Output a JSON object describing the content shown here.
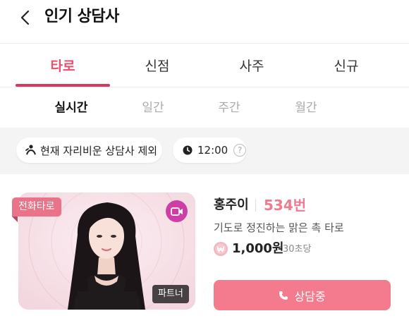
{
  "header": {
    "title": "인기 상담사",
    "back_icon": "chevron-left-icon"
  },
  "tabs": [
    {
      "label": "타로",
      "active": true
    },
    {
      "label": "신점",
      "active": false
    },
    {
      "label": "사주",
      "active": false
    },
    {
      "label": "신규",
      "active": false
    }
  ],
  "subtabs": [
    {
      "label": "실시간",
      "active": true
    },
    {
      "label": "일간",
      "active": false
    },
    {
      "label": "주간",
      "active": false
    },
    {
      "label": "월간",
      "active": false
    }
  ],
  "filters": {
    "away_toggle": {
      "label": "현재 자리비운 상담사 제외",
      "icon": "person-off-icon"
    },
    "time": {
      "label": "12:00",
      "icon": "clock-icon",
      "help": "?"
    }
  },
  "counselor": {
    "type_badge": "전화타로",
    "partner_badge": "파트너",
    "name": "홍주이",
    "number": "534번",
    "description": "기도로 정진하는 맑은 촉 타로",
    "price": "1,000원",
    "per": "30초당",
    "price_icon": "won-icon",
    "action_label": "상담중",
    "action_icon": "phone-icon",
    "video_icon": "video-camera-icon"
  },
  "colors": {
    "accent": "#e94f6c",
    "underline": "#d7385b",
    "button": "#f47b8d",
    "badge": "#ea7389",
    "video": "#cd3fa6"
  }
}
